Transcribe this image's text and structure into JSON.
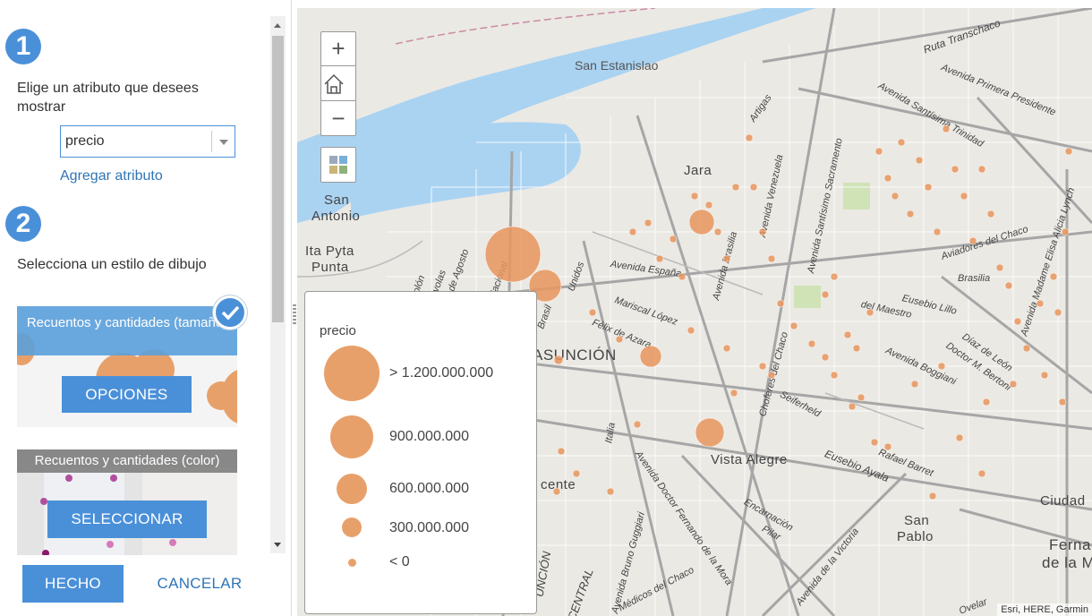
{
  "panel": {
    "step1": {
      "number": "1",
      "title": "Elige un atributo que desees mostrar"
    },
    "attribute_select": {
      "value": "precio"
    },
    "add_attribute_link": "Agregar atributo",
    "step2": {
      "number": "2",
      "title": "Selecciona un estilo de dibujo"
    },
    "style_cards": [
      {
        "title": "Recuentos y cantidades (tamaño)",
        "button": "OPCIONES",
        "selected": true
      },
      {
        "title": "Recuentos y cantidades (color)",
        "button": "SELECCIONAR",
        "selected": false
      }
    ],
    "done_button": "HECHO",
    "cancel_button": "CANCELAR"
  },
  "map": {
    "controls": {
      "zoom_in": "+",
      "home": "home-icon",
      "zoom_out": "−",
      "basemap": "basemap-gallery-icon"
    },
    "labels": {
      "san_estanislao": "San Estanislao",
      "san_antonio_1": "San",
      "san_antonio_2": "Antonio",
      "ita_pyta_1": "Ita Pyta",
      "ita_pyta_2": "Punta",
      "jara": "Jara",
      "asuncion": "ASUNCIÓN",
      "vista_alegre": "Vista Alegre",
      "ciudad": "Ciudad",
      "san_pablo_1": "San",
      "san_pablo_2": "Pablo",
      "ferna_1": "Ferna",
      "ferna_2": "de la M",
      "centre": "cente",
      "ruta_transchaco": "Ruta Transchaco",
      "av_primera_presidente": "Avenida Primera Presidente",
      "av_santisima_trinidad": "Avenida Santísima Trinidad",
      "av_santisimo_sacramento": "Avenida Santísimo Sacramento",
      "artigas": "Artigas",
      "av_venezuela": "Avenida Venezuela",
      "av_brasilia": "Avenida Brasilia",
      "av_espana": "Avenida España",
      "mariscal_lopez": "Mariscal López",
      "felix_de_azara": "Félix de Azara",
      "choferes_del_chaco": "Choferes del Chaco",
      "aviadores_del_chaco": "Aviadores del Chaco",
      "av_madame_elisa_alicia_lynch": "Avenida Madame Elisa Alicia Lynch",
      "del_maestro": "del Maestro",
      "eusebio_lillo": "Eusebio Lillo",
      "brasilia": "Brasilia",
      "av_boggiani": "Avenida Boggiani",
      "doctor_m_bertoni": "Doctor M. Bertoni",
      "diaz_de_leon": "Díaz de León",
      "seiferheld": "Seiferheld",
      "rafael_barret": "Rafael Barret",
      "eusebio_ayala": "Eusebio Ayala",
      "av_dr_fernando_de_la_mora": "Avenida Doctor Fernando de la Mora",
      "av_de_la_victoria": "Avenida de la Victoria",
      "av_bruno_guggiari": "Avenida Bruno Guggiari",
      "encarnacion": "Encarnación",
      "pilar": "Pilar",
      "medicos_del_chaco": "Médicos del Chaco",
      "italia": "Italia",
      "colon": "Colón",
      "ayolas": "Ayolas",
      "de_agosto": "de Agosto",
      "nacional": "Nacional",
      "unidos": "Unidos",
      "brasil": "Brasil",
      "central": "CENTRAL",
      "asuncion_2": "UNCIÓN",
      "ovelar": "Ovelar"
    },
    "attribution": "Esri, HERE, Garmin"
  },
  "legend": {
    "title": "precio",
    "items": [
      {
        "label": "> 1.200.000.000"
      },
      {
        "label": "900.000.000"
      },
      {
        "label": "600.000.000"
      },
      {
        "label": "300.000.000"
      },
      {
        "label": "< 0"
      }
    ]
  },
  "colors": {
    "accent": "#4a90d9",
    "symbol": "#e8a06a",
    "symbol_dark": "#e07a3a",
    "water": "#aad3f2",
    "park": "#cfe3b7"
  }
}
